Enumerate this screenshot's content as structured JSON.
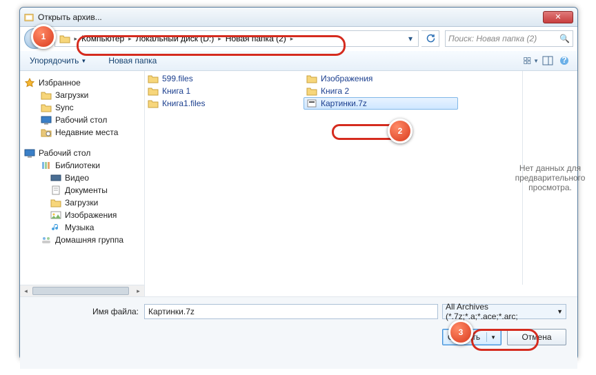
{
  "title": "Открыть архив...",
  "breadcrumb": {
    "root_sep": "",
    "items": [
      "Компьютер",
      "Локальный диск (D:)",
      "Новая папка (2)"
    ]
  },
  "search_placeholder": "Поиск: Новая папка (2)",
  "toolbar": {
    "organize": "Упорядочить",
    "new_folder": "Новая папка"
  },
  "tree": {
    "favorites": "Избранное",
    "downloads": "Загрузки",
    "sync": "Sync",
    "desktop_fav": "Рабочий стол",
    "recent": "Недавние места",
    "desktop": "Рабочий стол",
    "libraries": "Библиотеки",
    "videos": "Видео",
    "documents": "Документы",
    "downloads2": "Загрузки",
    "pictures": "Изображения",
    "music": "Музыка",
    "homegroup": "Домашняя группа"
  },
  "files": {
    "col1": [
      "599.files",
      "Книга 1",
      "Книга1.files"
    ],
    "col2": [
      "Изображения",
      "Книга 2",
      "Картинки.7z"
    ]
  },
  "preview_text": "Нет данных для предварительного просмотра.",
  "footer": {
    "filename_label": "Имя файла:",
    "filename_value": "Картинки.7z",
    "filter": "All Archives (*.7z;*.a;*.ace;*.arc;",
    "open": "Открыть",
    "cancel": "Отмена"
  },
  "callouts": {
    "c1": "1",
    "c2": "2",
    "c3": "3"
  }
}
